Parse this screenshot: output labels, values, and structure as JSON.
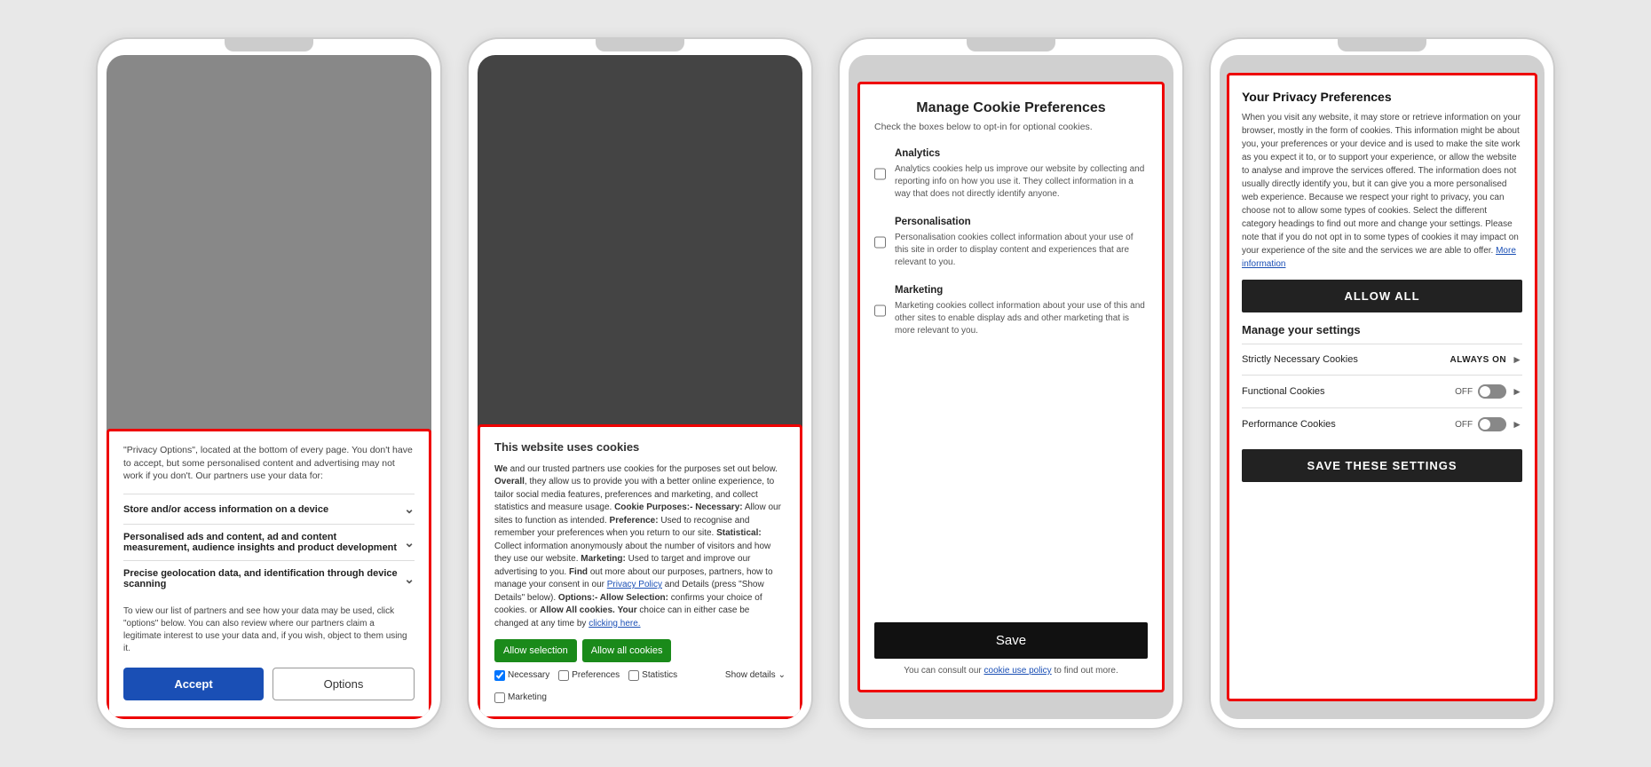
{
  "phone1": {
    "intro": "\"Privacy Options\", located at the bottom of every page. You don't have to accept, but some personalised content and advertising may not work if you don't. Our partners use your data for:",
    "option1": {
      "label": "Store and/or access information on a device",
      "has_chevron": true
    },
    "option2": {
      "label": "Personalised ads and content, ad and content measurement, audience insights and product development",
      "has_chevron": true
    },
    "option3": {
      "label": "Precise geolocation data, and identification through device scanning",
      "has_chevron": true
    },
    "footer_text": "To view our list of partners and see how your data may be used, click \"options\" below. You can also review where our partners claim a legitimate interest to use your data and, if you wish, object to them using it.",
    "accept_btn": "Accept",
    "options_btn": "Options"
  },
  "phone2": {
    "title": "This website uses cookies",
    "body": "We and our trusted partners use cookies for the purposes set out below. Overall, they allow us to provide you with a better online experience, to tailor social media features, preferences and marketing, and collect statistics and measure usage.",
    "cookie_purposes_label": "Cookie Purposes:-",
    "necessary_label": "Necessary:",
    "necessary_text": "Allow our sites to function as intended.",
    "preference_label": "Preference:",
    "preference_text": "Used to recognise and remember your preferences when you return to our site.",
    "statistical_label": "Statistical:",
    "statistical_text": "Collect information anonymously about the number of visitors and how they use our website.",
    "marketing_label": "Marketing:",
    "marketing_text": "Used to target and improve our advertising to you.",
    "find_out": "Find out more about our purposes, partners, how to manage your consent in our",
    "privacy_policy_link": "Privacy Policy",
    "details_text": "and Details (press \"Show Details\" below).",
    "options_label": "Options:-",
    "allow_selection_label": "Allow Selection:",
    "allow_selection_text": "confirms your choice of cookies. or",
    "allow_all_label": "Allow All cookies.",
    "your_choice_text": "Your choice can in either case be changed at any time by",
    "clicking_here": "clicking here.",
    "btn_allow_selection": "Allow selection",
    "btn_allow_all": "Allow all cookies",
    "check_necessary": "Necessary",
    "check_preferences": "Preferences",
    "check_statistics": "Statistics",
    "check_marketing": "Marketing",
    "show_details": "Show details"
  },
  "phone3": {
    "title": "Manage Cookie Preferences",
    "subtitle": "Check the boxes below to opt-in for optional cookies.",
    "analytics_label": "Analytics",
    "analytics_text": "Analytics cookies help us improve our website by collecting and reporting info on how you use it. They collect information in a way that does not directly identify anyone.",
    "personalisation_label": "Personalisation",
    "personalisation_text": "Personalisation cookies collect information about your use of this site in order to display content and experiences that are relevant to you.",
    "marketing_label": "Marketing",
    "marketing_text": "Marketing cookies collect information about your use of this and other sites to enable display ads and other marketing that is more relevant to you.",
    "save_btn": "Save",
    "consult_text": "You can consult our",
    "cookie_policy_link": "cookie use policy",
    "consult_text2": "to find out more."
  },
  "phone4": {
    "title": "Your Privacy Preferences",
    "desc": "When you visit any website, it may store or retrieve information on your browser, mostly in the form of cookies. This information might be about you, your preferences or your device and is used to make the site work as you expect it to, or to support your experience, or allow the website to analyse and improve the services offered. The information does not usually directly identify you, but it can give you a more personalised web experience. Because we respect your right to privacy, you can choose not to allow some types of cookies. Select the different category headings to find out more and change your settings. Please note that if you do not opt in to some types of cookies it may impact on your experience of the site and the services we are able to offer.",
    "more_info_link": "More information",
    "allow_all_btn": "ALLOW ALL",
    "manage_settings": "Manage your settings",
    "strictly_necessary": "Strictly Necessary Cookies",
    "strictly_necessary_status": "ALWAYS ON",
    "functional_cookies": "Functional Cookies",
    "functional_status": "OFF",
    "performance_cookies": "Performance Cookies",
    "performance_status": "OFF",
    "save_settings_btn": "SAVE THESE SETTINGS"
  }
}
